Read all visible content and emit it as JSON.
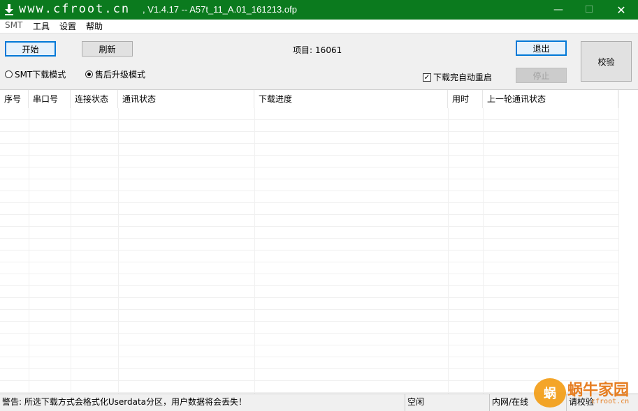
{
  "window": {
    "title_site": "www.cfroot.cn",
    "title_rest": ", V1.4.17 -- A57t_11_A.01_161213.ofp",
    "minimize": "—",
    "maximize": "☐",
    "close": "✕",
    "accent": "#0b7a1e"
  },
  "menu": {
    "items": [
      "SMT",
      "工具",
      "设置",
      "帮助"
    ]
  },
  "toolbar": {
    "start_label": "开始",
    "refresh_label": "刷新",
    "project_label": "项目:",
    "project_value": "16061",
    "exit_label": "退出",
    "verify_label": "校验",
    "stop_label": "停止",
    "smt_mode_label": "SMT下载模式",
    "after_sales_mode_label": "售后升级模式",
    "auto_restart_label": "下载完自动重启",
    "auto_restart_checked": true,
    "selected_mode": "after_sales"
  },
  "table": {
    "columns": [
      "序号",
      "串口号",
      "连接状态",
      "通讯状态",
      "下载进度",
      "用时",
      "上一轮通讯状态"
    ],
    "rows": []
  },
  "statusbar": {
    "warning": "警告: 所选下载方式会格式化Userdata分区，用户数据将会丢失！",
    "state": "空闲",
    "network": "内网/在线",
    "verify": "请校验"
  },
  "watermark": {
    "logo_text": "蜗",
    "brand": "蜗牛家园",
    "url": "cfroot.cn"
  }
}
